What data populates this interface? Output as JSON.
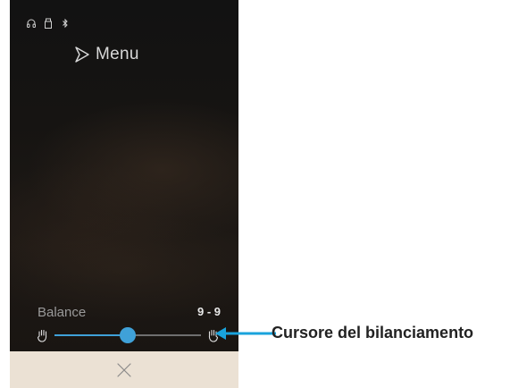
{
  "status_bar": {
    "icons": [
      "headphones-icon",
      "usb-icon",
      "bluetooth-icon"
    ]
  },
  "header": {
    "menu_label": "Menu",
    "menu_icon": "play-outline-icon"
  },
  "balance": {
    "label": "Balance",
    "value": "9 - 9",
    "slider_position_percent": 50,
    "left_icon": "hand-icon",
    "right_icon": "hand-icon"
  },
  "bottom_bar": {
    "close_icon": "close-icon"
  },
  "callout": {
    "text": "Cursore del bilanciamento"
  },
  "colors": {
    "accent": "#3fa1d8",
    "bottom_bar": "#ebe1d4",
    "screen_bg": "#141312",
    "callout_arrow": "#19a3dc"
  }
}
